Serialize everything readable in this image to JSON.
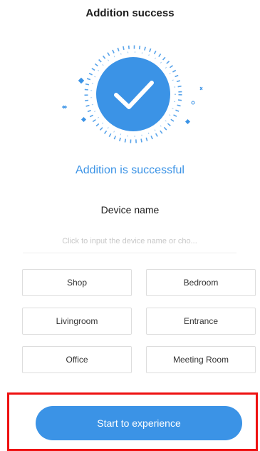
{
  "header": {
    "title": "Addition success"
  },
  "status": {
    "icon": "check-circle-icon",
    "message": "Addition is successful",
    "accent_color": "#3b93e6"
  },
  "device_name": {
    "label": "Device name",
    "placeholder": "Click to input the device name or cho...",
    "value": ""
  },
  "presets": [
    {
      "label": "Shop"
    },
    {
      "label": "Bedroom"
    },
    {
      "label": "Livingroom"
    },
    {
      "label": "Entrance"
    },
    {
      "label": "Office"
    },
    {
      "label": "Meeting Room"
    }
  ],
  "footer": {
    "start_label": "Start to experience"
  }
}
